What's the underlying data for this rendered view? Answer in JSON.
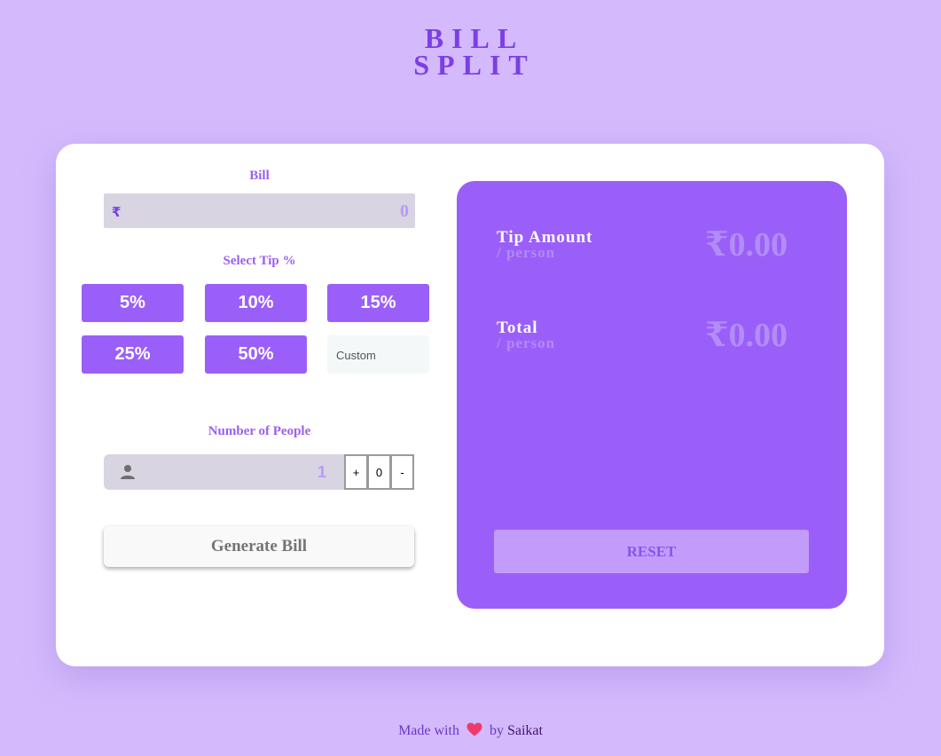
{
  "app": {
    "title_line1": "BILL",
    "title_line2": "SPLIT"
  },
  "bill": {
    "label": "Bill",
    "currency_icon": "rupee-icon",
    "currency_symbol": "₹",
    "value": "0"
  },
  "tip": {
    "label": "Select Tip %",
    "options": [
      "5%",
      "10%",
      "15%",
      "25%",
      "50%"
    ],
    "custom_placeholder": "Custom"
  },
  "people": {
    "label": "Number of People",
    "icon": "person-icon",
    "value": "1",
    "increment_label": "+",
    "counter_value": "0",
    "decrement_label": "-"
  },
  "generate": {
    "label": "Generate Bill"
  },
  "results": {
    "tip_amount_label": "Tip Amount",
    "tip_amount_sub": "/ person",
    "tip_amount_value": "₹0.00",
    "total_label": "Total",
    "total_sub": "/ person",
    "total_value": "₹0.00",
    "reset_label": "RESET"
  },
  "footer": {
    "made_with": "Made with",
    "heart_icon": "heart-icon",
    "by": "by",
    "author": "Saikat"
  },
  "colors": {
    "background": "#d4bafd",
    "accent": "#9b5ff9",
    "title": "#7b3fe4",
    "card": "#ffffff"
  }
}
